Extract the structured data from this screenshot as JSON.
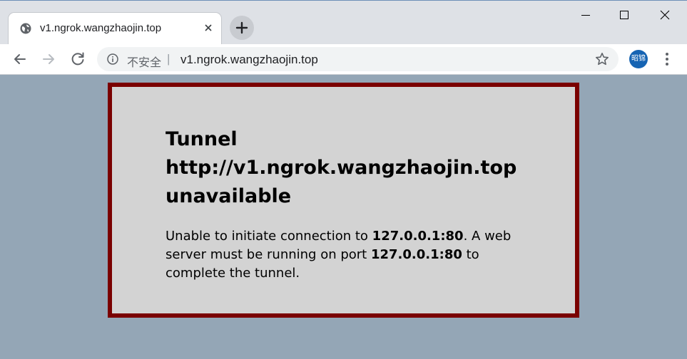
{
  "browser": {
    "tab": {
      "title": "v1.ngrok.wangzhaojin.top",
      "favicon": "globe-icon"
    },
    "address_bar": {
      "security_label": "不安全",
      "separator": "|",
      "url": "v1.ngrok.wangzhaojin.top"
    },
    "profile": {
      "avatar_text": "昭锦",
      "color": "#1664b3"
    }
  },
  "page": {
    "title_line1": "Tunnel",
    "title_line2": "http://v1.ngrok.wangzhaojin.top",
    "title_line3": "unavailable",
    "msg_part1": "Unable to initiate connection to ",
    "addr1": "127.0.0.1:80",
    "msg_part2": ". A web server must be running on port ",
    "addr2": "127.0.0.1:80",
    "msg_part3": " to complete the tunnel.",
    "colors": {
      "background": "#94a6b6",
      "box_fill": "#d3d3d3",
      "box_border": "#7a0000"
    }
  }
}
